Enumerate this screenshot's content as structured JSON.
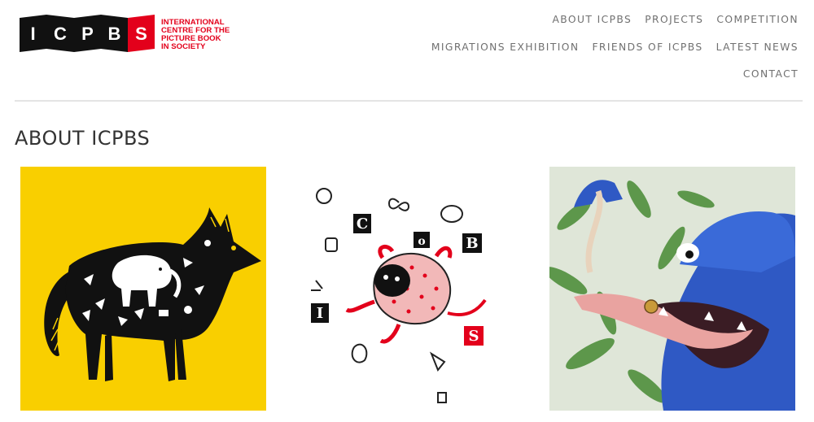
{
  "logo": {
    "letters": [
      "I",
      "C",
      "P",
      "B",
      "S"
    ],
    "text_lines": [
      "INTERNATIONAL",
      "CENTRE FOR THE",
      "PICTURE BOOK",
      "IN SOCIETY"
    ],
    "colors": {
      "black": "#111111",
      "red": "#e3001b"
    }
  },
  "nav": {
    "row1": [
      "ABOUT ICPBS",
      "PROJECTS",
      "COMPETITION"
    ],
    "row2": [
      "MIGRATIONS EXHIBITION",
      "FRIENDS OF ICPBS",
      "LATEST NEWS"
    ],
    "row3": [
      "CONTACT"
    ]
  },
  "page": {
    "title": "ABOUT ICPBS"
  },
  "gallery": {
    "tiles": [
      {
        "subject": "black folk-art animal on yellow",
        "background": "#f9cf00"
      },
      {
        "subject": "figure tumbling among letters and objects",
        "background": "#ffffff",
        "block_letters": [
          "C",
          "o",
          "B",
          "I",
          "S"
        ]
      },
      {
        "subject": "blue furry monster eating a worm",
        "background": "#dfe6d8"
      }
    ]
  },
  "colors": {
    "accent": "#e3001b",
    "nav_text": "#707070",
    "divider": "#e4e4e4"
  }
}
